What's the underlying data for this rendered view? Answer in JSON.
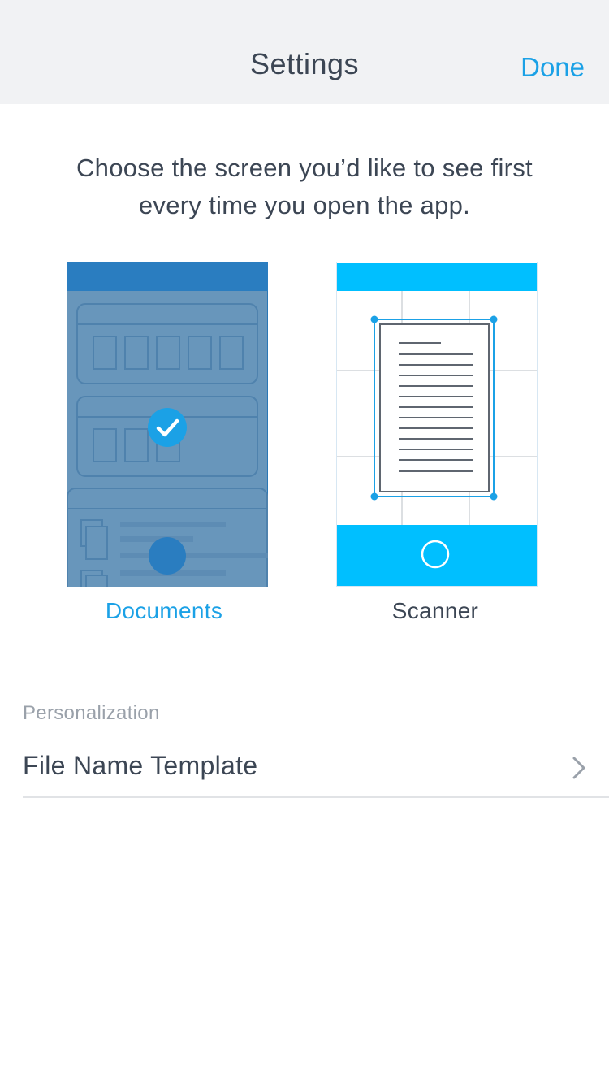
{
  "navbar": {
    "title": "Settings",
    "done_label": "Done"
  },
  "intro": {
    "line1": "Choose the screen you’d like to see first",
    "line2": "every time you open the app."
  },
  "start_screen": {
    "options": [
      {
        "label": "Documents",
        "selected": true,
        "icon": "documents-preview"
      },
      {
        "label": "Scanner",
        "selected": false,
        "icon": "scanner-preview"
      }
    ]
  },
  "personalization": {
    "header": "Personalization",
    "items": [
      {
        "label": "File Name Template",
        "icon": "chevron-right-icon"
      }
    ]
  },
  "colors": {
    "accent": "#1BA1E6",
    "scanner_bar": "#00BFFF"
  }
}
